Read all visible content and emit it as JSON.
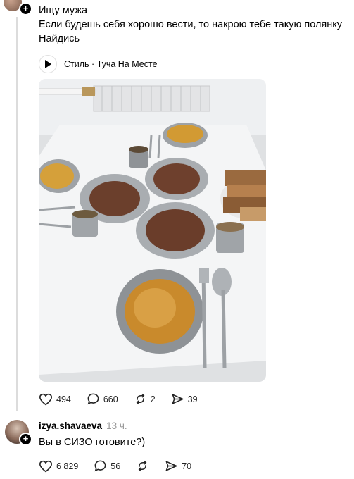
{
  "post": {
    "title": "Ищу мужа",
    "line1": "Если будешь себя хорошо вести, то накрою тебе такую полянку",
    "line2": "Найдись",
    "music_label": "Стиль · Туча На Месте",
    "stats": {
      "likes": "494",
      "comments": "660",
      "reposts": "2",
      "shares": "39"
    }
  },
  "reply": {
    "username": "izya.shavaeva",
    "time": "13 ч.",
    "text": "Вы в СИЗО готовите?)",
    "stats": {
      "likes": "6 829",
      "comments": "56",
      "shares": "70"
    }
  },
  "icons": [
    "avatar",
    "plus-icon",
    "play-icon",
    "heart-icon",
    "comment-icon",
    "repost-icon",
    "share-icon"
  ]
}
